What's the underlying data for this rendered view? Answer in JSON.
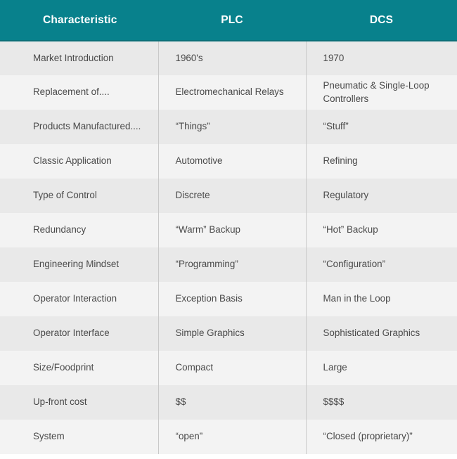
{
  "table": {
    "columns": [
      {
        "key": "characteristic",
        "label": "Characteristic",
        "align": "left"
      },
      {
        "key": "plc",
        "label": "PLC",
        "align": "center"
      },
      {
        "key": "dcs",
        "label": "DCS",
        "align": "center"
      }
    ],
    "header_bg": "#08818c",
    "header_text_color": "#ffffff",
    "row_bg_odd": "#e9e9e9",
    "row_bg_even": "#f3f3f3",
    "body_text_color": "#4a4a4a",
    "divider_color": "#c9c9c9",
    "rows": [
      {
        "characteristic": "Market Introduction",
        "plc": "1960's",
        "dcs": "1970"
      },
      {
        "characteristic": "Replacement of....",
        "plc": "Electromechanical Relays",
        "dcs": "Pneumatic & Single-Loop Controllers"
      },
      {
        "characteristic": "Products Manufactured....",
        "plc": "“Things”",
        "dcs": "“Stuff”"
      },
      {
        "characteristic": "Classic Application",
        "plc": "Automotive",
        "dcs": "Refining"
      },
      {
        "characteristic": "Type of Control",
        "plc": "Discrete",
        "dcs": "Regulatory"
      },
      {
        "characteristic": "Redundancy",
        "plc": "“Warm” Backup",
        "dcs": "“Hot” Backup"
      },
      {
        "characteristic": "Engineering Mindset",
        "plc": "“Programming”",
        "dcs": "“Configuration”"
      },
      {
        "characteristic": "Operator Interaction",
        "plc": "Exception Basis",
        "dcs": "Man in the Loop"
      },
      {
        "characteristic": "Operator Interface",
        "plc": "Simple Graphics",
        "dcs": "Sophisticated Graphics"
      },
      {
        "characteristic": "Size/Foodprint",
        "plc": "Compact",
        "dcs": "Large"
      },
      {
        "characteristic": "Up-front cost",
        "plc": "$$",
        "dcs": "$$$$"
      },
      {
        "characteristic": "System",
        "plc": "“open”",
        "dcs": "“Closed (proprietary)”"
      }
    ]
  }
}
